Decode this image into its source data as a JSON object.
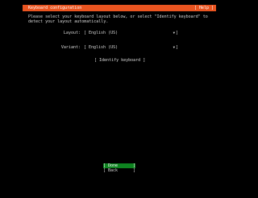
{
  "title": "Keyboard configuration",
  "help": "[ Help ]",
  "intro": "Please select your keyboard layout below, or select \"Identify keyboard\" to detect your layout automatically.",
  "layout": {
    "label": "Layout:",
    "value": "English (US)"
  },
  "variant": {
    "label": "Variant:",
    "value": "English (US)"
  },
  "identify": "[ Identify keyboard ]",
  "buttons": {
    "done": "Done",
    "back": "Back"
  },
  "glyphs": {
    "left": "[",
    "right": "]",
    "dropdown": "▼",
    "focus": "]"
  },
  "colors": {
    "titlebar": "#e95420",
    "focused_button": "#0e8420"
  }
}
